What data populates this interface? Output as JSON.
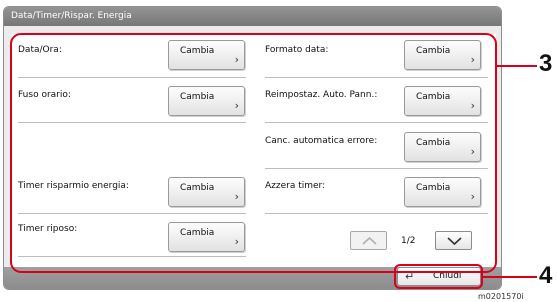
{
  "window": {
    "title": "Data/Timer/Rispar. Energia"
  },
  "settings": {
    "left": [
      {
        "label": "Data/Ora:",
        "button": "Cambia"
      },
      {
        "label": "Fuso orario:",
        "button": "Cambia"
      },
      {
        "label": "Timer risparmio energia:",
        "button": "Cambia"
      },
      {
        "label": "Timer riposo:",
        "button": "Cambia"
      }
    ],
    "right": [
      {
        "label": "Formato data:",
        "button": "Cambia"
      },
      {
        "label": "Reimpostaz. Auto. Pann.:",
        "button": "Cambia"
      },
      {
        "label": "Canc. automatica errore:",
        "button": "Cambia"
      },
      {
        "label": "Azzera timer:",
        "button": "Cambia"
      }
    ]
  },
  "pagination": {
    "indicator": "1/2",
    "prev_icon": "chevron-up-icon",
    "next_icon": "chevron-down-icon"
  },
  "footer": {
    "close_label": "Chiudi",
    "close_icon": "return-arrow-icon"
  },
  "annotations": {
    "callout_settings": "3",
    "callout_close": "4",
    "figure_code": "m0201570i"
  },
  "colors": {
    "callout": "#d9001b",
    "titlebar": "#868686"
  }
}
